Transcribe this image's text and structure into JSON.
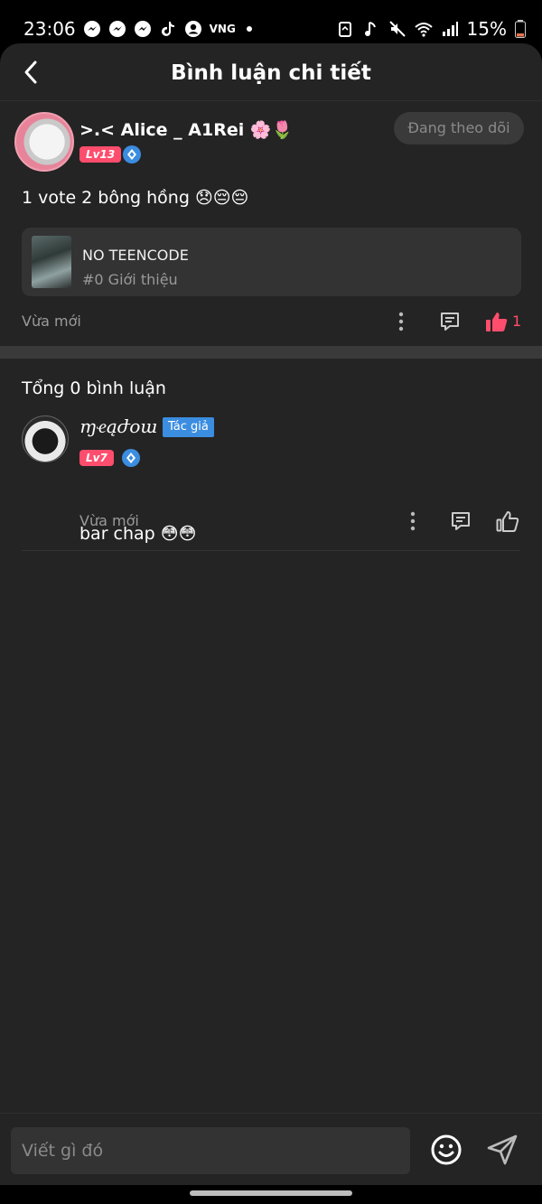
{
  "status_bar": {
    "time": "23:06",
    "carrier_label": "VNG",
    "battery": "15%",
    "left_icons": [
      "messenger-icon",
      "messenger-icon",
      "messenger-icon",
      "tiktok-icon",
      "account-icon"
    ],
    "right_icons": [
      "recycle-icon",
      "music-note-icon",
      "mute-icon",
      "wifi-icon",
      "signal-icon",
      "battery-icon"
    ]
  },
  "header": {
    "title": "Bình luận chi tiết",
    "back_icon": "chevron-left-icon"
  },
  "main_comment": {
    "user_name": ">.< Alice _ A1Rei 🌸🌷",
    "level": "Lv13",
    "follow_label": "Đang theo dõi",
    "text": "1 vote 2 bông hồng 😞😔😔",
    "ref_card": {
      "title": "NO TEENCODE",
      "subtitle": "#0 Giới thiệu"
    },
    "time": "Vừa mới",
    "like_count": "1",
    "liked": true
  },
  "replies_section": {
    "total_label": "Tổng 0 bình luận",
    "replies": [
      {
        "user_name": "ɱҽąժօա",
        "author_tag": "Tác giả",
        "level": "Lv7",
        "text": "bar chap 😳😳",
        "time": "Vừa mới"
      }
    ]
  },
  "input_bar": {
    "placeholder": "Viết gì đó"
  },
  "colors": {
    "background": "#242424",
    "accent_pink": "#ff4d6d",
    "accent_blue": "#3b8de0",
    "muted_text": "#9a9a9a"
  }
}
